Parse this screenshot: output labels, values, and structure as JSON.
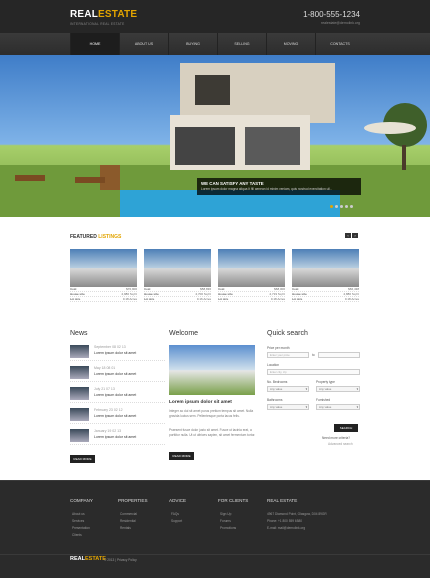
{
  "brand": {
    "logo_main": "REAL",
    "logo_accent": "ESTATE",
    "tagline": "INTERNATIONAL REAL ESTATE",
    "phone": "1-800-555-1234",
    "email": "realestate@demolink.org"
  },
  "nav": [
    "HOME",
    "ABOUT US",
    "BUYING",
    "SELLING",
    "MOVING",
    "CONTACTS"
  ],
  "hero": {
    "caption_title": "WE CAN SATISFY ANY TASTE",
    "caption_text": "Lorem ipsum dolor magna aliqua It fill aenean id minim veniam, quis nostrud exercitation ull.."
  },
  "featured": {
    "title_main": "FEATURED",
    "title_accent": "LISTINGS",
    "listings": [
      {
        "cost": "$70,900",
        "house_size": "2,980 Sq Ft",
        "lot_size": "0.18 Acres"
      },
      {
        "cost": "$58,836",
        "house_size": "2,700 Sq Ft",
        "lot_size": "0.16 Acres"
      },
      {
        "cost": "$68,000",
        "house_size": "2,719 Sq Ft",
        "lot_size": "0.18 Acres"
      },
      {
        "cost": "$66,438",
        "house_size": "2,880 Sq Ft",
        "lot_size": "0.18 Acres"
      }
    ]
  },
  "news": {
    "title": "News",
    "items": [
      {
        "date": "September 08 02 13",
        "link": "Lorem ipsum dolor sit amet"
      },
      {
        "date": "May 18 08 01",
        "link": "Lorem ipsum dolor sit amet"
      },
      {
        "date": "July 21 07 13",
        "link": "Lorem ipsum dolor sit amet"
      },
      {
        "date": "February 23 02 12",
        "link": "Lorem ipsum dolor sit amet"
      },
      {
        "date": "January 19 02 13",
        "link": "Lorem ipsum dolor sit amet"
      }
    ],
    "button": "READ MORE"
  },
  "welcome": {
    "title": "Welcome",
    "subtitle": "Lorem ipsum dolor sit amet",
    "para1": "Integer ac dui sit amet purus pretium tempus sit amet. Nulla gravida luctus sem. Pellentesque porta lacus felis.",
    "para2": "Praesent fusce dolor justo sit amet. Fusce ut lacinia erat, a porttitor nulla. Ut ut ultrices sapien, sit amet fermentum tortor.",
    "button": "READ MORE"
  },
  "quick_search": {
    "title": "Quick search",
    "price_label": "Price per month",
    "price_from": "Enter your price",
    "price_to": "to",
    "location_label": "Location",
    "location_placeholder": "Enter city, zip",
    "bedrooms_label": "No. Bedrooms",
    "bedrooms_value": "Any value",
    "property_label": "Property type",
    "property_value": "Any value",
    "bathrooms_label": "Bathrooms",
    "bathrooms_value": "Any value",
    "furnished_label": "Furnished",
    "furnished_value": "Any value",
    "search_button": "SEARCH",
    "more_options": "Need more criteria?",
    "advanced": "Advanced search"
  },
  "footer": {
    "columns": [
      {
        "title": "COMPANY",
        "items": [
          "About us",
          "Services",
          "Presentation",
          "Clients"
        ]
      },
      {
        "title": "PROPERTIES",
        "items": [
          "Commercial",
          "Residential",
          "Rentals"
        ]
      },
      {
        "title": "ADVICE",
        "items": [
          "FAQs",
          "Support"
        ]
      },
      {
        "title": "FOR CLIENTS",
        "items": [
          "Sign Up",
          "Forums",
          "Promotions"
        ]
      }
    ],
    "contact_title": "REAL ESTATE",
    "contact_lines": [
      "4967 Diamond Point, Glasgow, D04 89GR",
      "Phone: +1 800 559 6580",
      "E-mail: mail@demolink.org"
    ],
    "copyright": "© 2013",
    "privacy": "Privacy Policy"
  }
}
